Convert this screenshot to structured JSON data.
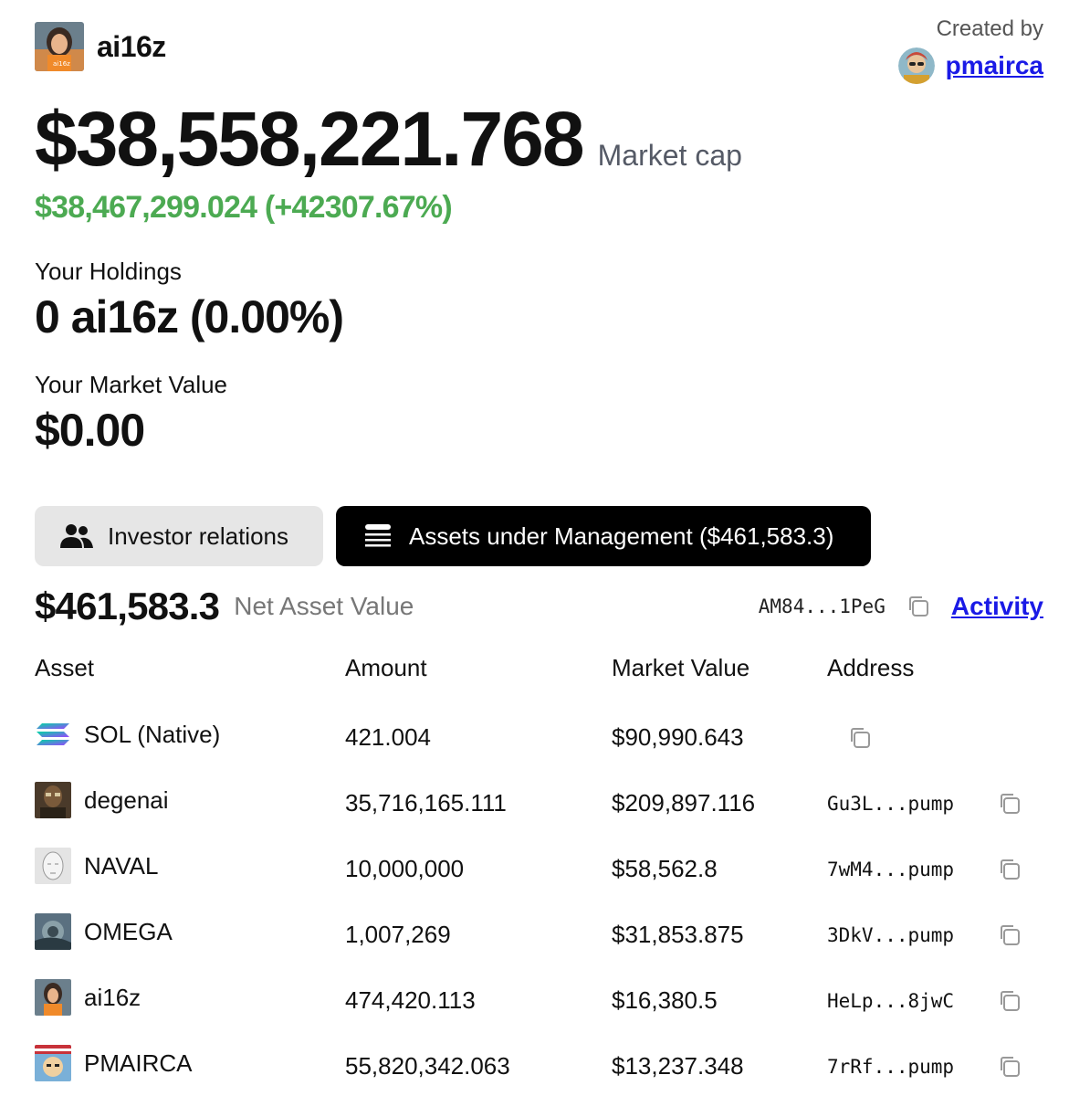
{
  "token": {
    "name": "ai16z"
  },
  "creator": {
    "label": "Created by",
    "handle": "pmairca"
  },
  "market_cap": {
    "value": "$38,558,221.768",
    "label": "Market cap",
    "change": "$38,467,299.024 (+42307.67%)"
  },
  "holdings": {
    "label": "Your Holdings",
    "value": "0 ai16z (0.00%)"
  },
  "market_value": {
    "label": "Your Market Value",
    "value": "$0.00"
  },
  "tabs": [
    {
      "label": "Investor relations",
      "icon": "users-icon",
      "active": false
    },
    {
      "label": "Assets under Management ($461,583.3)",
      "icon": "list-icon",
      "active": true
    }
  ],
  "nav": {
    "value": "$461,583.3",
    "label": "Net Asset Value",
    "wallet": "AM84...1PeG",
    "activity": "Activity"
  },
  "table": {
    "headers": [
      "Asset",
      "Amount",
      "Market Value",
      "Address"
    ],
    "rows": [
      {
        "asset": "SOL (Native)",
        "amount": "421.004",
        "market_value": "$90,990.643",
        "address": ""
      },
      {
        "asset": "degenai",
        "amount": "35,716,165.111",
        "market_value": "$209,897.116",
        "address": "Gu3L...pump"
      },
      {
        "asset": "NAVAL",
        "amount": "10,000,000",
        "market_value": "$58,562.8",
        "address": "7wM4...pump"
      },
      {
        "asset": "OMEGA",
        "amount": "1,007,269",
        "market_value": "$31,853.875",
        "address": "3DkV...pump"
      },
      {
        "asset": "ai16z",
        "amount": "474,420.113",
        "market_value": "$16,380.5",
        "address": "HeLp...8jwC"
      },
      {
        "asset": "PMAIRCA",
        "amount": "55,820,342.063",
        "market_value": "$13,237.348",
        "address": "7rRf...pump"
      }
    ]
  },
  "colors": {
    "positive": "#4caa52",
    "link": "#1a1ae6",
    "active_tab": "#000000",
    "inactive_tab": "#e6e6e6"
  }
}
